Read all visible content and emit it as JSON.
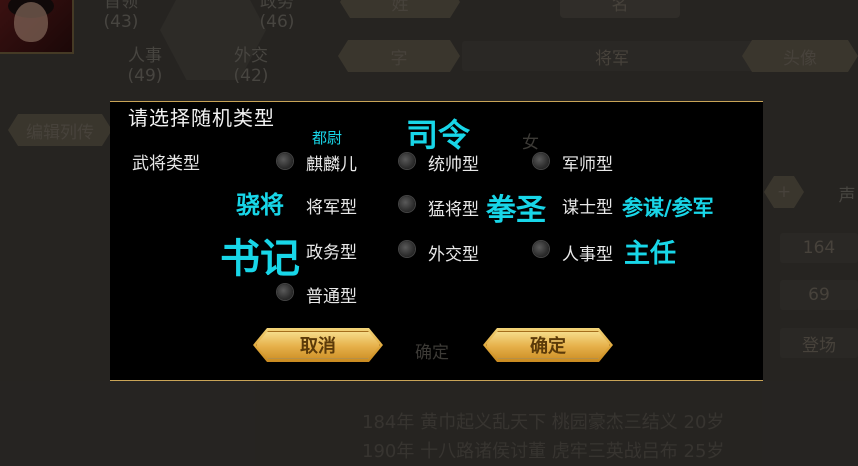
{
  "background": {
    "stats": [
      {
        "label": "首领",
        "value": "(43)"
      },
      {
        "label": "政务",
        "value": "(46)"
      },
      {
        "label": "人事",
        "value": "(49)"
      },
      {
        "label": "外交",
        "value": "(42)"
      }
    ],
    "edit_list_button": "编辑列传",
    "top_buttons": [
      "姓",
      "名"
    ],
    "style_button": "字",
    "rank_field": "将军",
    "avatar_button": "头像",
    "plus_label": "+",
    "sound_label": "声",
    "value_1": "164",
    "value_2": "69",
    "register_label": "登场",
    "bio_lines": [
      "184年 黄巾起义乱天下 桃园豪杰三结义 20岁",
      "190年 十八路诸侯讨董 虎牢三英战吕布 25岁"
    ]
  },
  "dialog": {
    "title": "请选择随机类型",
    "row_label": "武将类型",
    "options": {
      "qilin": "麒麟儿",
      "commander": "统帅型",
      "strategist": "军师型",
      "general": "将军型",
      "fierce": "猛将型",
      "advisor": "谋士型",
      "politics": "政务型",
      "diplomacy": "外交型",
      "personnel": "人事型",
      "normal": "普通型"
    },
    "annotations": {
      "duwei": "都尉",
      "siling": "司令",
      "xiaojiang": "骁将",
      "quansheng": "拳圣",
      "canmou": "参谋/参军",
      "shuji": "书记",
      "zhuren": "主任"
    },
    "cancel_label": "取消",
    "confirm_label": "确定",
    "faded_text": "确定",
    "faded_text_2": "女"
  },
  "colors": {
    "annotation": "#18d6e8",
    "dialog_border": "#c9a457",
    "button_gold": "#e0a83c"
  }
}
